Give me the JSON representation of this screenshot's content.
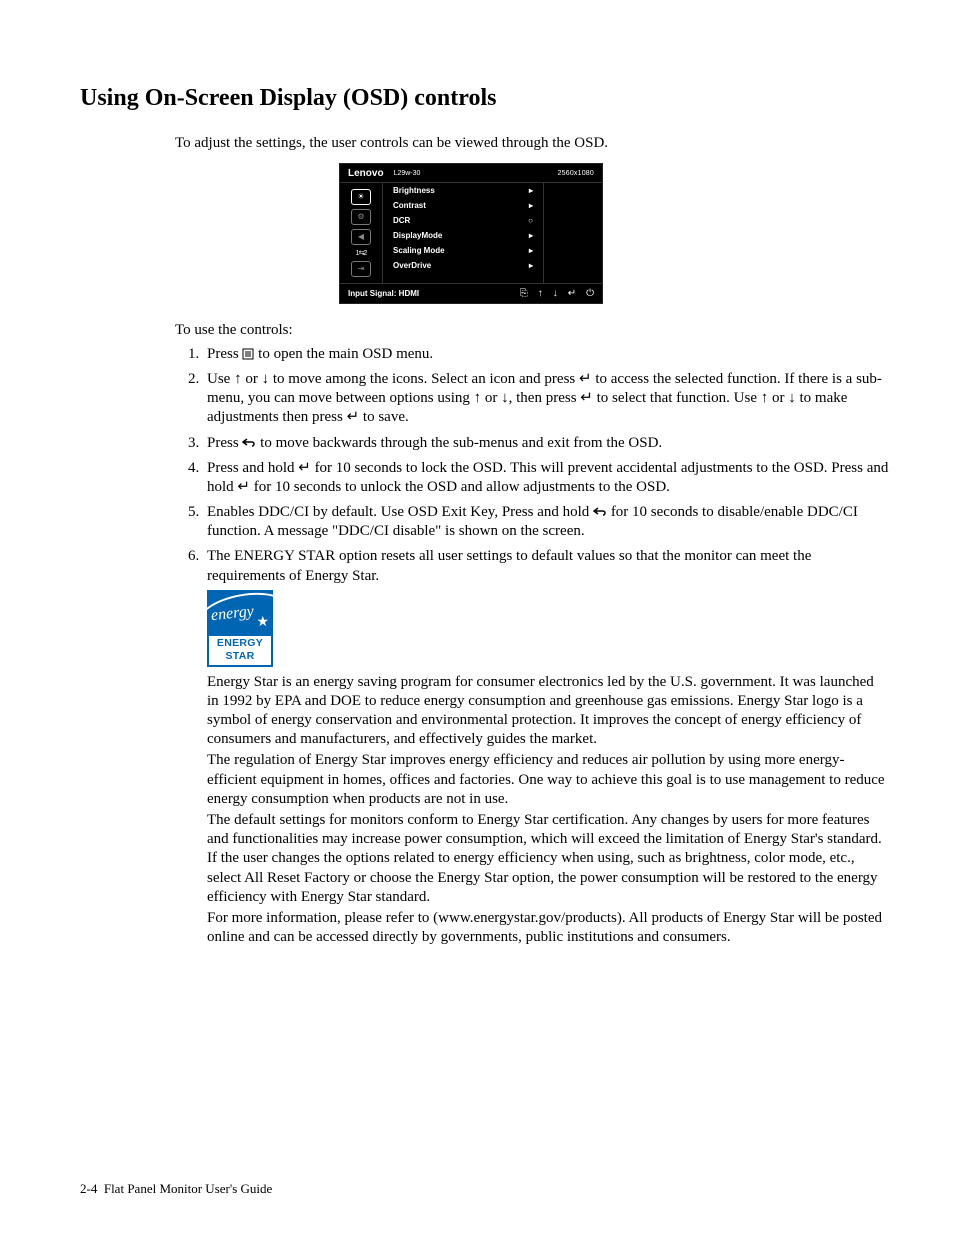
{
  "title": "Using On-Screen Display (OSD) controls",
  "intro": "To adjust the settings, the user controls can be viewed through the OSD.",
  "osd": {
    "brand": "Lenovo",
    "model": "L29w-30",
    "resolution": "2560x1080",
    "items": [
      {
        "label": "Brightness",
        "marker": "▸"
      },
      {
        "label": "Contrast",
        "marker": "▸"
      },
      {
        "label": "DCR",
        "marker": "○"
      },
      {
        "label": "DisplayMode",
        "marker": "▸"
      },
      {
        "label": "Scaling Mode",
        "marker": "▸"
      },
      {
        "label": "OverDrive",
        "marker": "▸"
      }
    ],
    "switch_label": "1⇆2",
    "signal": "Input Signal: HDMI",
    "controls": [
      "⎘",
      "↑",
      "↓",
      "↵",
      "⏻"
    ]
  },
  "steps_lead": "To use the controls:",
  "steps": {
    "s1a": "Press ",
    "s1b": " to open the main OSD menu.",
    "s2a": "Use ",
    "s2b": " or ",
    "s2c": " to move among the icons. Select an icon and press ",
    "s2d": " to access the selected function. If there is a sub-menu, you can move between options using ",
    "s2e": " or ",
    "s2f": ", then press ",
    "s2g": " to select that function. Use ",
    "s2h": " or ",
    "s2i": " to make adjustments then press ",
    "s2j": " to save.",
    "s3a": "Press ",
    "s3b": " to move backwards through the sub-menus and exit from the OSD.",
    "s4": "Press and hold ↵ for 10 seconds to lock the OSD. This will prevent accidental adjustments to the OSD. Press and hold ↵ for 10 seconds to unlock the OSD and allow adjustments to the OSD.",
    "s5a": "Enables DDC/CI by default. Use OSD Exit Key, Press and hold ",
    "s5b": " for 10 seconds to disable/enable DDC/CI function. A message \"DDC/CI disable\" is shown on the screen.",
    "s6": "The ENERGY STAR option resets all user settings to default values so that the monitor can meet the requirements of Energy Star."
  },
  "energystar": {
    "script": "energy",
    "label": "ENERGY STAR"
  },
  "paras": {
    "p1": "Energy Star is an energy saving program for consumer electronics led by the U.S. government. It was launched in 1992 by EPA and DOE to reduce energy consumption and greenhouse gas emissions. Energy Star logo is a symbol of energy conservation and environmental protection. It improves the concept of energy efficiency of consumers and manufacturers, and effectively guides the market.",
    "p2": "The regulation of Energy Star improves energy efficiency and reduces air pollution by using more energy-efficient equipment in homes, offices and factories. One way to achieve this goal is to use management to reduce energy consumption when products are not in use.",
    "p3": "The default settings for monitors conform to Energy Star certification. Any changes by users for more features and functionalities may increase power consumption, which will exceed the limitation of Energy Star's standard. If the user changes the options related to energy efficiency when using, such as brightness, color mode, etc., select All Reset Factory or choose the Energy Star option, the power consumption will be restored to the energy efficiency with Energy Star standard.",
    "p4": "For more information, please refer to (www.energystar.gov/products). All products of Energy Star will be posted online and can be accessed directly by governments, public institutions and consumers."
  },
  "footer": {
    "page": "2-4",
    "doc": "Flat Panel Monitor User's Guide"
  }
}
